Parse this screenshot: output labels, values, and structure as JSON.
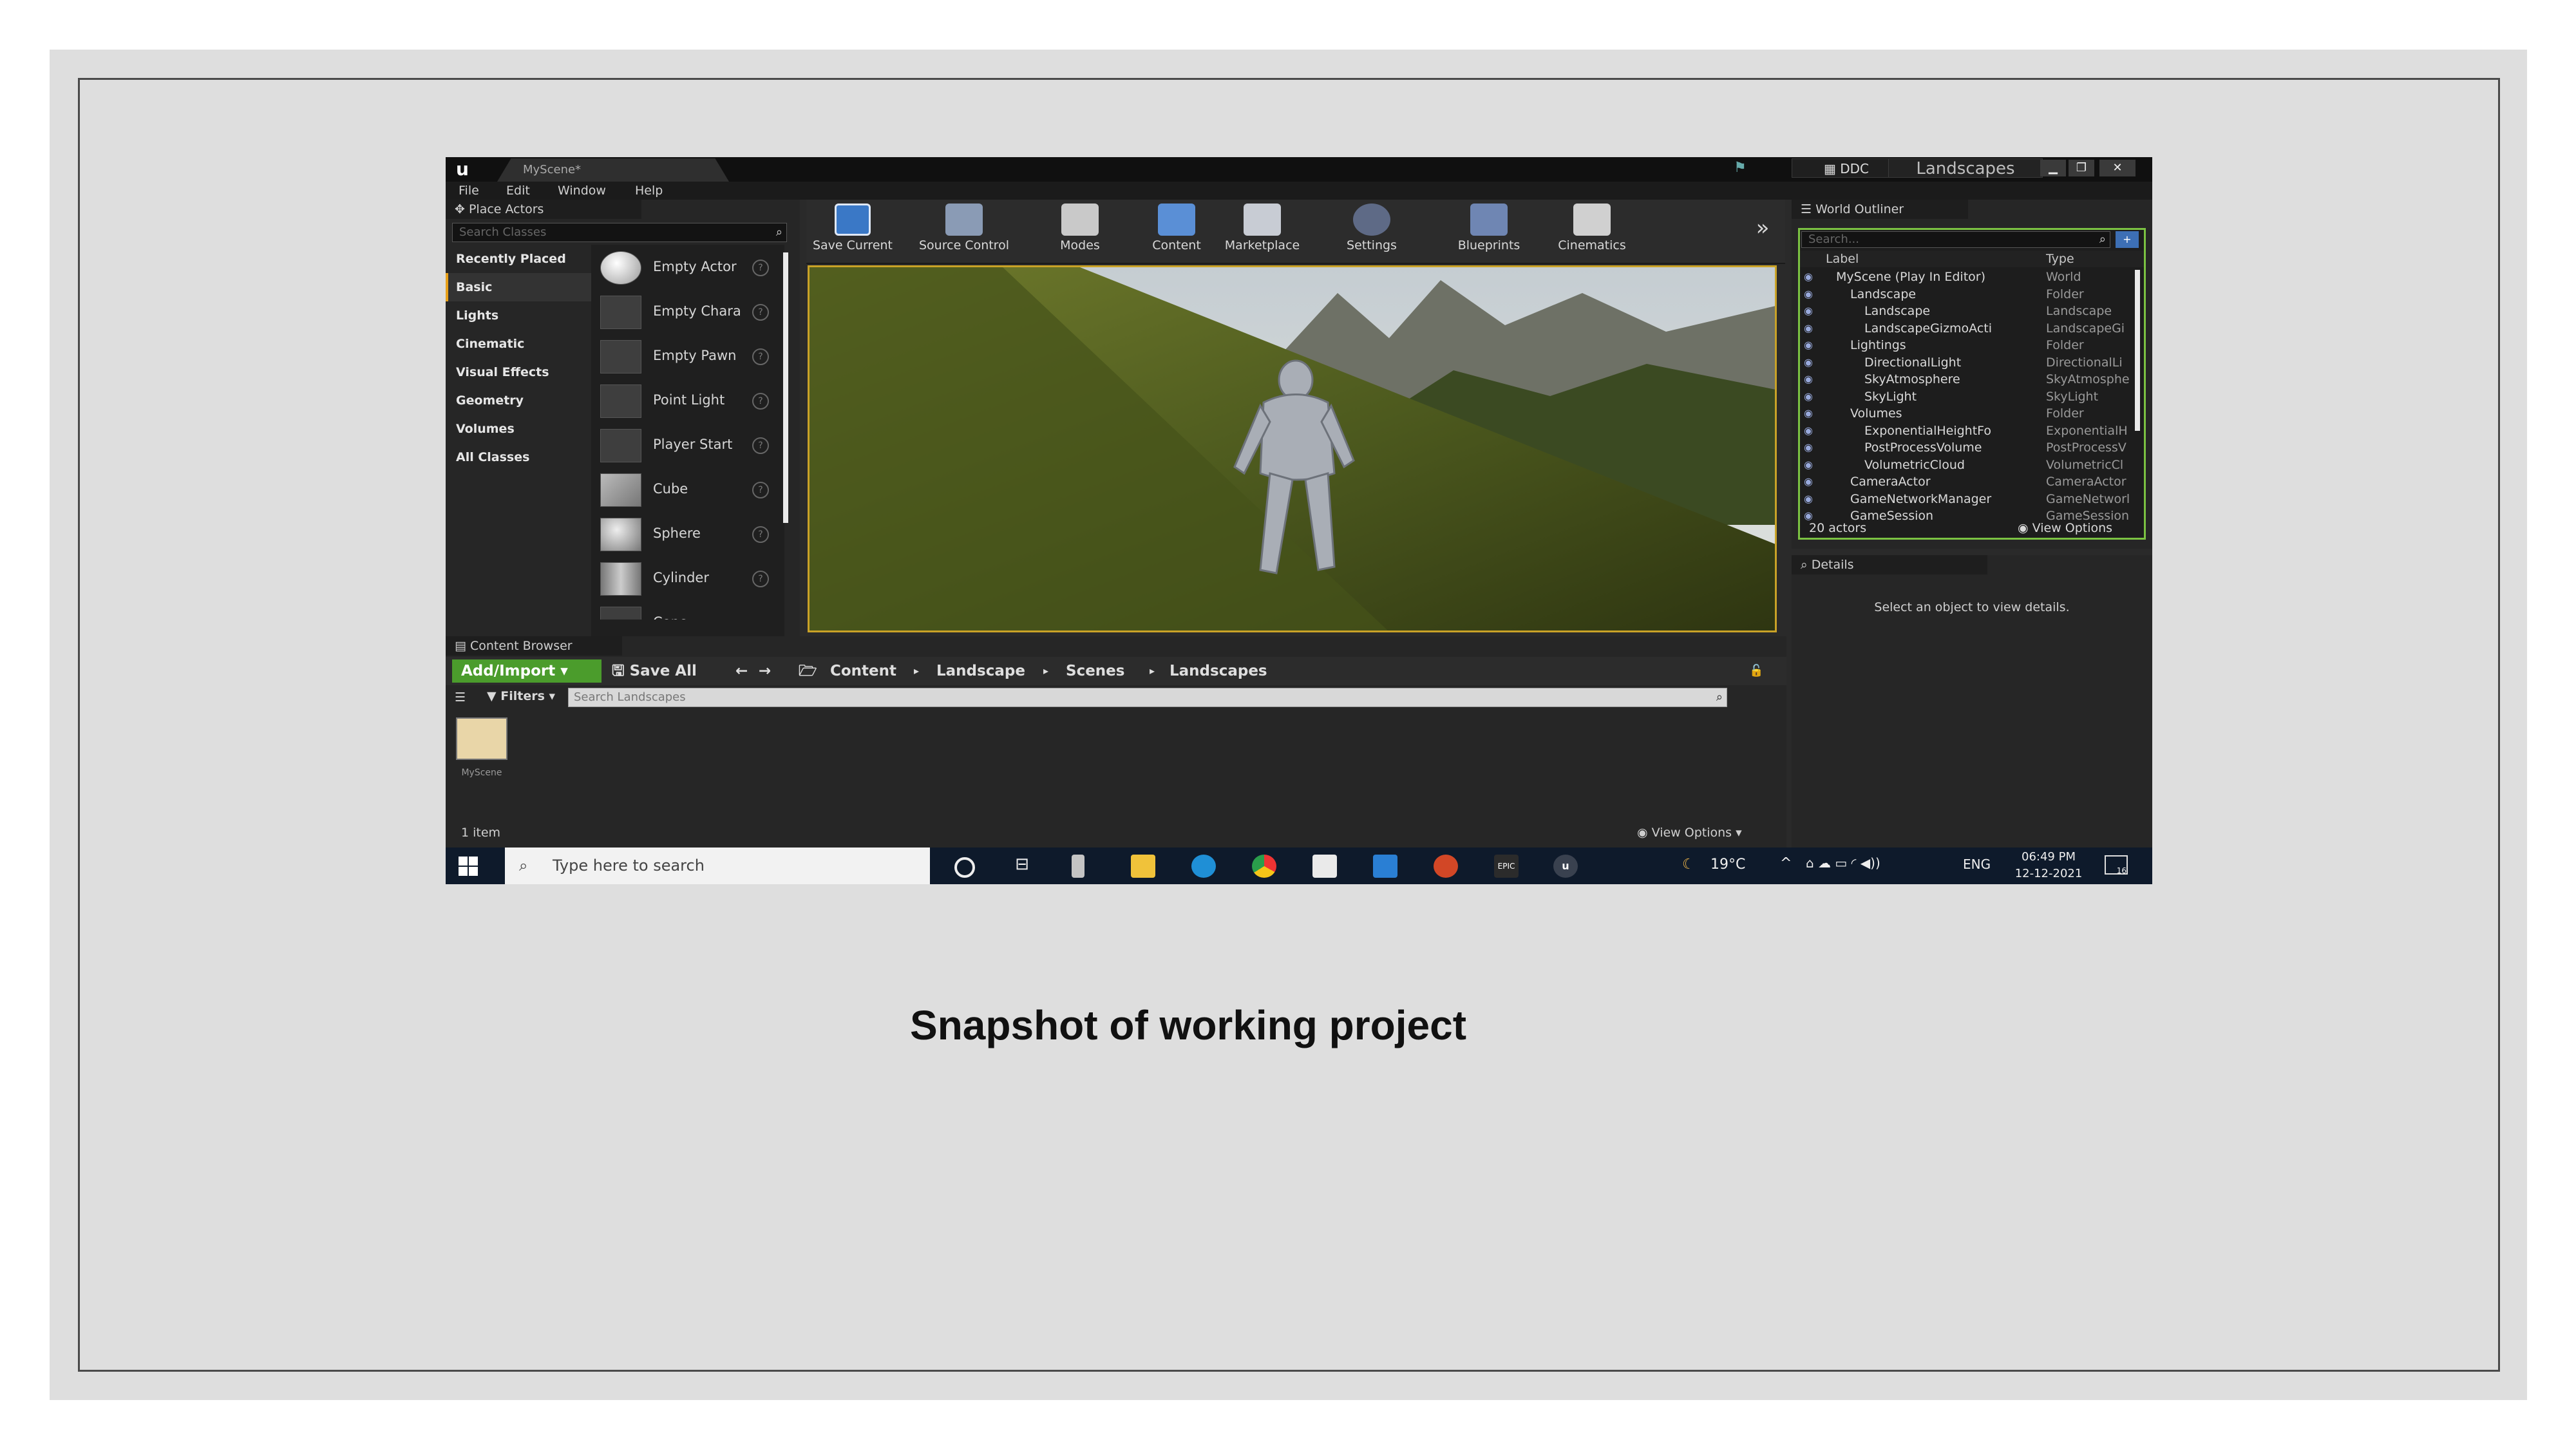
{
  "slide": {
    "caption": "Snapshot of working project"
  },
  "editor": {
    "scene_tab": "MyScene*",
    "ddc_label": "DDC",
    "project_name": "Landscapes",
    "menu": [
      "File",
      "Edit",
      "Window",
      "Help"
    ],
    "place_actors": {
      "tab_label": "Place Actors",
      "search_placeholder": "Search Classes",
      "categories": [
        "Recently Placed",
        "Basic",
        "Lights",
        "Cinematic",
        "Visual Effects",
        "Geometry",
        "Volumes",
        "All Classes"
      ],
      "selected_category": "Basic",
      "actors": [
        "Empty Actor",
        "Empty Chara",
        "Empty Pawn",
        "Point Light",
        "Player Start",
        "Cube",
        "Sphere",
        "Cylinder",
        "Cone"
      ]
    },
    "toolbar": {
      "save_current": "Save Current",
      "source_control": "Source Control",
      "modes": "Modes",
      "content": "Content",
      "marketplace": "Marketplace",
      "settings": "Settings",
      "blueprints": "Blueprints",
      "cinematics": "Cinematics",
      "overflow": "»"
    },
    "world_outliner": {
      "tab_label": "World Outliner",
      "search_placeholder": "Search...",
      "col_label": "Label",
      "col_type": "Type",
      "rows": [
        {
          "label": "MyScene (Play In Editor)",
          "type": "World",
          "indent": 0
        },
        {
          "label": "Landscape",
          "type": "Folder",
          "indent": 1
        },
        {
          "label": "Landscape",
          "type": "Landscape",
          "indent": 2
        },
        {
          "label": "LandscapeGizmoActi",
          "type": "LandscapeGi",
          "indent": 2
        },
        {
          "label": "Lightings",
          "type": "Folder",
          "indent": 1
        },
        {
          "label": "DirectionalLight",
          "type": "DirectionalLi",
          "indent": 2
        },
        {
          "label": "SkyAtmosphere",
          "type": "SkyAtmosphe",
          "indent": 2
        },
        {
          "label": "SkyLight",
          "type": "SkyLight",
          "indent": 2
        },
        {
          "label": "Volumes",
          "type": "Folder",
          "indent": 1
        },
        {
          "label": "ExponentialHeightFo",
          "type": "ExponentialH",
          "indent": 2
        },
        {
          "label": "PostProcessVolume",
          "type": "PostProcessV",
          "indent": 2
        },
        {
          "label": "VolumetricCloud",
          "type": "VolumetricCl",
          "indent": 2
        },
        {
          "label": "CameraActor",
          "type": "CameraActor",
          "indent": 1
        },
        {
          "label": "GameNetworkManager",
          "type": "GameNetworl",
          "indent": 1
        },
        {
          "label": "GameSession",
          "type": "GameSession",
          "indent": 1
        }
      ],
      "actor_count": "20 actors",
      "view_options": "View Options"
    },
    "details": {
      "tab_label": "Details",
      "empty_message": "Select an object to view details."
    },
    "content_browser": {
      "tab_label": "Content Browser",
      "add_import": "Add/Import",
      "save_all": "Save All",
      "breadcrumb": [
        "Content",
        "Landscape",
        "Scenes",
        "Landscapes"
      ],
      "filters": "Filters",
      "search_placeholder": "Search Landscapes",
      "asset_name": "MyScene",
      "item_count": "1 item",
      "view_options": "View Options"
    }
  },
  "taskbar": {
    "search_placeholder": "Type here to search",
    "weather": "19°C",
    "language": "ENG",
    "time": "06:49 PM",
    "date": "12-12-2021",
    "notification_count": "16"
  }
}
